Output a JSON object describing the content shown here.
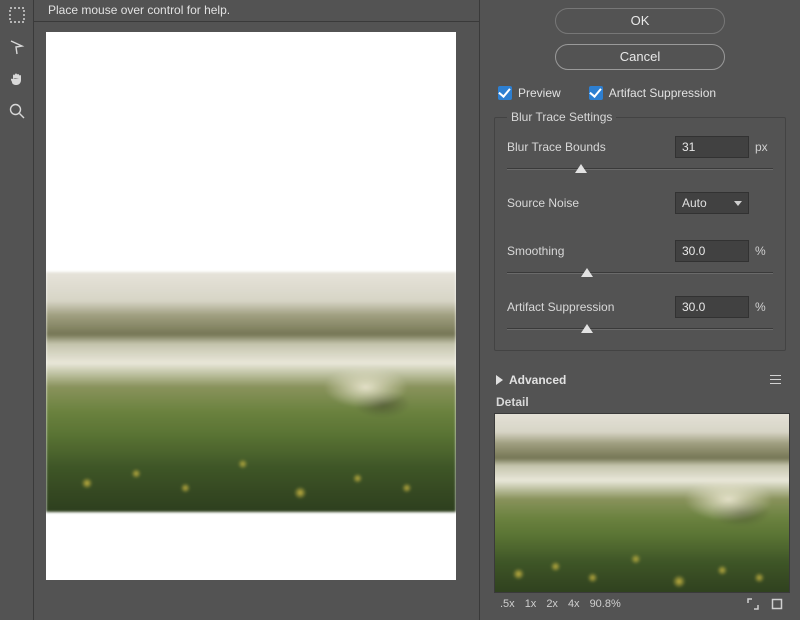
{
  "hint": "Place mouse over control for help.",
  "buttons": {
    "ok": "OK",
    "cancel": "Cancel"
  },
  "checks": {
    "preview": "Preview",
    "artifact_suppression": "Artifact Suppression"
  },
  "group_title": "Blur Trace Settings",
  "settings": {
    "blur_trace_bounds": {
      "label": "Blur Trace Bounds",
      "value": "31",
      "unit": "px",
      "pos_pct": 28
    },
    "source_noise": {
      "label": "Source Noise",
      "value": "Auto"
    },
    "smoothing": {
      "label": "Smoothing",
      "value": "30.0",
      "unit": "%",
      "pos_pct": 30
    },
    "artifact_suppression": {
      "label": "Artifact Suppression",
      "value": "30.0",
      "unit": "%",
      "pos_pct": 30
    }
  },
  "advanced": {
    "label": "Advanced"
  },
  "detail": {
    "label": "Detail",
    "zoom_levels": [
      ".5x",
      "1x",
      "2x",
      "4x"
    ],
    "zoom_value": "90.8%"
  }
}
